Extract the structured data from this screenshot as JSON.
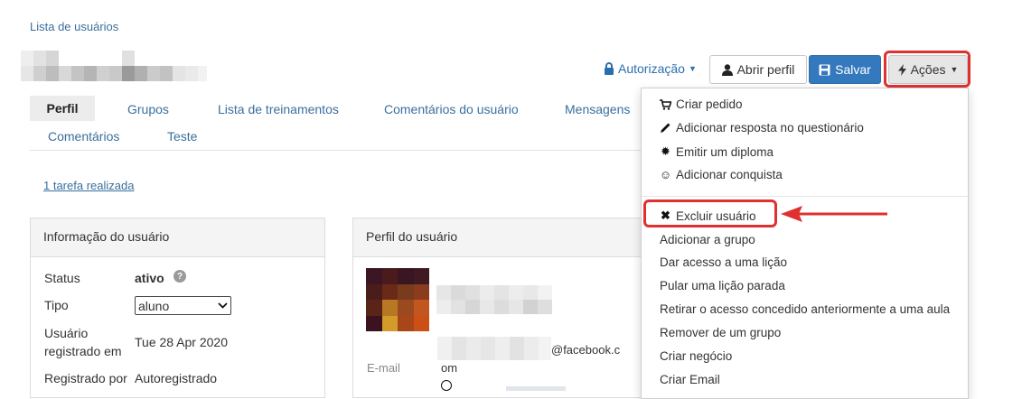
{
  "breadcrumb": "Lista de usuários",
  "header": {
    "authorization_label": "Autorização",
    "open_profile_label": "Abrir perfil",
    "save_label": "Salvar",
    "actions_label": "Ações"
  },
  "tabs": [
    {
      "label": "Perfil"
    },
    {
      "label": "Grupos"
    },
    {
      "label": "Lista de treinamentos"
    },
    {
      "label": "Comentários do usuário"
    },
    {
      "label": "Mensagens"
    },
    {
      "label": "Comentários"
    },
    {
      "label": "Teste"
    }
  ],
  "tasks_link": "1 tarefa realizada",
  "user_info": {
    "title": "Informação do usuário",
    "status_label": "Status",
    "status_value": "ativo",
    "help_icon": "?",
    "type_label": "Tipo",
    "type_value": "aluno",
    "registered_label_1": "Usuário",
    "registered_label_2": "registrado em",
    "registered_value": "Tue 28 Apr 2020",
    "registered_by_label": "Registrado por",
    "registered_by_value": "Autoregistrado"
  },
  "user_profile": {
    "title": "Perfil do usuário",
    "email_label": "E-mail",
    "email_suffix_1": "@facebook.c",
    "email_suffix_2": "om"
  },
  "actions_menu": {
    "items": [
      {
        "label": "Criar pedido",
        "icon": "cart-icon"
      },
      {
        "label": "Adicionar resposta no questionário",
        "icon": "pencil-icon"
      },
      {
        "label": "Emitir um diploma",
        "icon": "certificate-icon"
      },
      {
        "label": "Adicionar conquista",
        "icon": "smile-icon"
      },
      {
        "label": "Excluir usuário",
        "icon": "x-icon"
      },
      {
        "label": "Adicionar a grupo"
      },
      {
        "label": "Dar acesso a uma lição"
      },
      {
        "label": "Pular uma lição parada"
      },
      {
        "label": "Retirar o acesso concedido anteriormente a uma aula"
      },
      {
        "label": "Remover de um grupo"
      },
      {
        "label": "Criar negócio"
      },
      {
        "label": "Criar Email"
      }
    ]
  },
  "colors": {
    "link": "#3a6f9e",
    "primary": "#3479bd",
    "highlight": "#e03131"
  }
}
